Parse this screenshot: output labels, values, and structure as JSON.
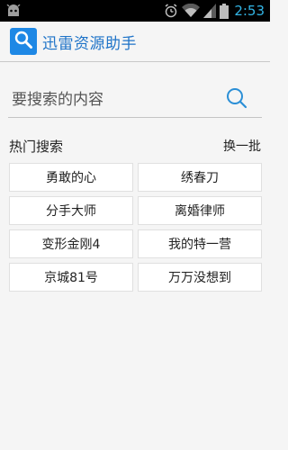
{
  "status_bar": {
    "time": "2:53",
    "icons": [
      "android-debug-icon",
      "alarm-icon",
      "wifi-icon",
      "signal-icon",
      "battery-icon"
    ]
  },
  "header": {
    "title": "迅雷资源助手",
    "logo_icon": "search-icon"
  },
  "search": {
    "placeholder": "要搜索的内容",
    "value": ""
  },
  "hot": {
    "title": "热门搜索",
    "refresh_label": "换一批",
    "items": [
      "勇敢的心",
      "绣春刀",
      "分手大师",
      "离婚律师",
      "变形金刚4",
      "我的特一营",
      "京城81号",
      "万万没想到"
    ]
  },
  "colors": {
    "accent": "#1e88e5",
    "title": "#1e73c8",
    "status_time": "#33b5e5",
    "background": "#f5f5f5"
  }
}
